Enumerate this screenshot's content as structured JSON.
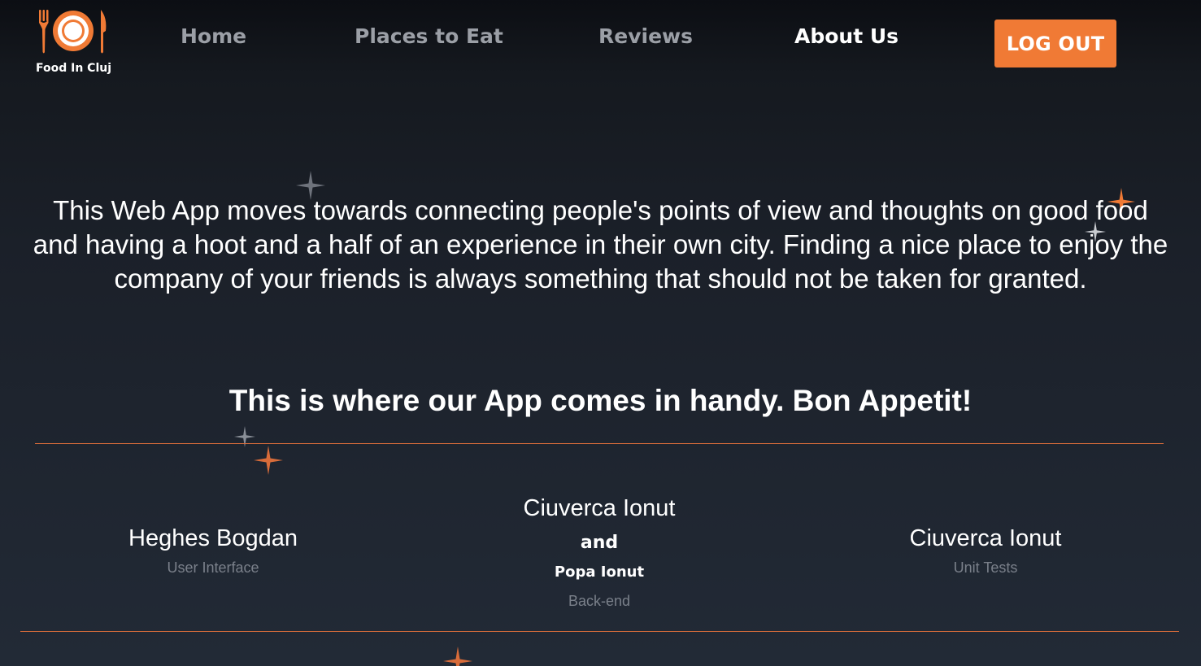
{
  "brand": {
    "name": "Food In Cluj",
    "logo_icon": "plate-fork-knife-icon",
    "accent_color": "#f07a35"
  },
  "nav": {
    "links": [
      {
        "label": "Home",
        "active": false
      },
      {
        "label": "Places to Eat",
        "active": false
      },
      {
        "label": "Reviews",
        "active": false
      },
      {
        "label": "About Us",
        "active": true
      }
    ],
    "logout_label": "LOG OUT"
  },
  "about": {
    "intro": "This Web App moves towards connecting people's points of view and thoughts on good food and having a hoot and a half of an experience in their own city. Finding a nice place to enjoy the company of your friends is always something that should not be taken for granted.",
    "tagline": "This is where our App comes in handy. Bon Appetit!"
  },
  "team": [
    {
      "name": "Heghes Bogdan",
      "role": "User Interface"
    },
    {
      "name": "Ciuverca Ionut",
      "connector": "and",
      "second_name": "Popa Ionut",
      "role": "Back-end"
    },
    {
      "name": "Ciuverca Ionut",
      "role": "Unit Tests"
    }
  ],
  "decorations": {
    "sparkle_icon": "four-point-star-icon",
    "colors": [
      "#f07a35",
      "#8a8f98"
    ]
  }
}
